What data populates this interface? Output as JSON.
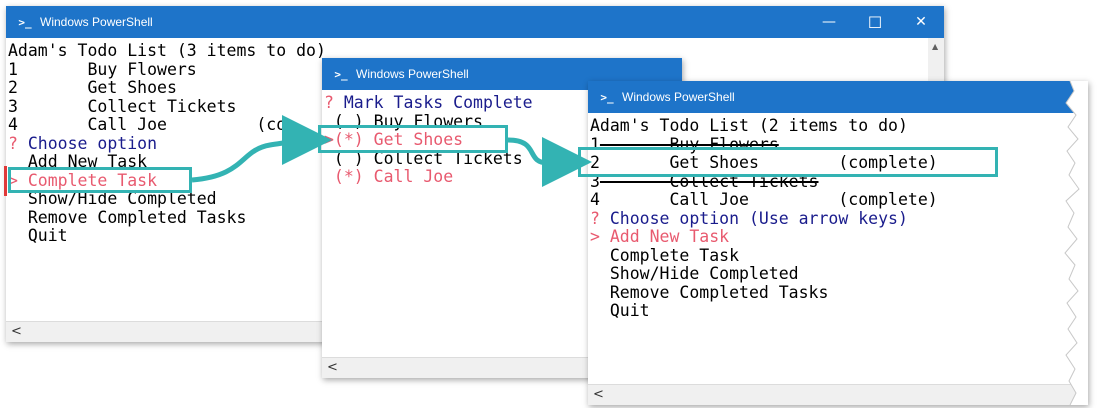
{
  "colors": {
    "titlebar": "#1e74c9",
    "highlight": "#33b3b3",
    "prompt_red": "#e85a6f",
    "navy": "#1a1c8c",
    "marker_red": "#e03a3a"
  },
  "windows": [
    {
      "title": "Windows PowerShell",
      "controls": {
        "minimize": "—",
        "maximize": "☐",
        "close": "✕"
      },
      "lines": [
        {
          "type": "plain",
          "text": "Adam's Todo List (3 items to do)"
        },
        {
          "type": "plain",
          "text": "1       Buy Flowers"
        },
        {
          "type": "plain",
          "text": "2       Get Shoes"
        },
        {
          "type": "plain",
          "text": "3       Collect Tickets"
        },
        {
          "type": "plain",
          "text": "4       Call Joe         (co"
        },
        {
          "type": "question",
          "mark": "?",
          "text": " Choose option"
        },
        {
          "type": "plain",
          "text": "  Add New Task"
        },
        {
          "type": "selected",
          "text": "> Complete Task"
        },
        {
          "type": "plain",
          "text": "  Show/Hide Completed"
        },
        {
          "type": "plain",
          "text": "  Remove Completed Tasks"
        },
        {
          "type": "plain",
          "text": "  Quit"
        }
      ]
    },
    {
      "title": "Windows PowerShell",
      "lines": [
        {
          "type": "question",
          "mark": "?",
          "text": " Mark Tasks Complete"
        },
        {
          "type": "plain",
          "text": " ( ) Buy Flowers"
        },
        {
          "type": "selected",
          "text": ">(*) Get Shoes"
        },
        {
          "type": "plain",
          "text": " ( ) Collect Tickets"
        },
        {
          "type": "starred",
          "text": " (*) Call Joe"
        }
      ]
    },
    {
      "title": "Windows PowerShell",
      "lines": [
        {
          "type": "plain",
          "text": "Adam's Todo List (2 items to do)"
        },
        {
          "type": "struck",
          "num": "1",
          "text": "       Buy Flowers"
        },
        {
          "type": "plain",
          "text": "2       Get Shoes        (complete)"
        },
        {
          "type": "struck",
          "num": "3",
          "text": "       Collect Tickets"
        },
        {
          "type": "plain",
          "text": "4       Call Joe         (complete)"
        },
        {
          "type": "question",
          "mark": "?",
          "text": " Choose option (Use arrow keys)"
        },
        {
          "type": "selected",
          "text": "> Add New Task"
        },
        {
          "type": "plain",
          "text": "  Complete Task"
        },
        {
          "type": "plain",
          "text": "  Show/Hide Completed"
        },
        {
          "type": "plain",
          "text": "  Remove Completed Tasks"
        },
        {
          "type": "plain",
          "text": "  Quit"
        }
      ]
    }
  ]
}
